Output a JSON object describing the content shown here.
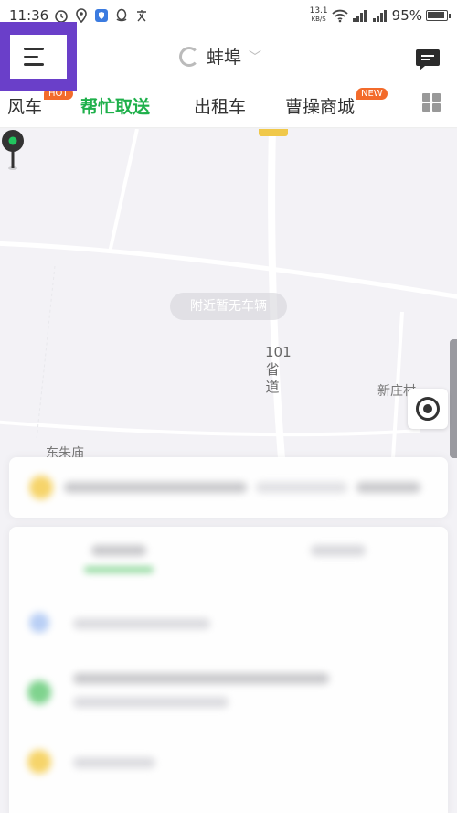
{
  "status_bar": {
    "time": "11:36",
    "net_speed_value": "13.1",
    "net_speed_unit": "KB/S",
    "battery": "95%",
    "battery_level": 0.95
  },
  "header": {
    "city": "蚌埠"
  },
  "tabs": [
    {
      "label": "风车",
      "badge": "HOT"
    },
    {
      "label": "帮忙取送",
      "active": true
    },
    {
      "label": "出租车"
    },
    {
      "label": "曹操商城",
      "badge": "NEW"
    }
  ],
  "map": {
    "no_vehicle_text": "附近暂无车辆",
    "road_label": "101省道",
    "place_1": "新庄村",
    "place_2": "东朱庙",
    "road_tag": "S101"
  },
  "colors": {
    "accent_green": "#1fb04b",
    "highlight_purple": "#6a3fc9",
    "badge_orange": "#f36b2b"
  },
  "icons": {
    "menu": "hamburger-menu-icon",
    "message": "chat-bubble-icon",
    "grid": "grid-apps-icon",
    "locate": "locate-target-icon",
    "pin": "map-pin-icon"
  }
}
